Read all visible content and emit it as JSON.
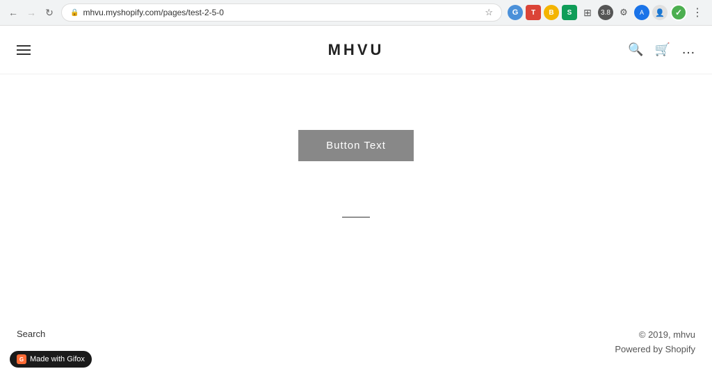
{
  "browser": {
    "back_disabled": false,
    "forward_disabled": true,
    "url": "mhvu.myshopify.com/pages/test-2-5-0",
    "star_label": "★"
  },
  "nav": {
    "hamburger_label": "☰",
    "title": "MHVU",
    "search_label": "🔍",
    "cart_label": "🛒",
    "more_label": "⋯"
  },
  "main": {
    "button_label": "Button Text"
  },
  "footer": {
    "search_link": "Search",
    "copyright": "© 2019, mhvu",
    "powered_by": "Powered by Shopify"
  },
  "gifox": {
    "label": "Made with Gifox"
  }
}
